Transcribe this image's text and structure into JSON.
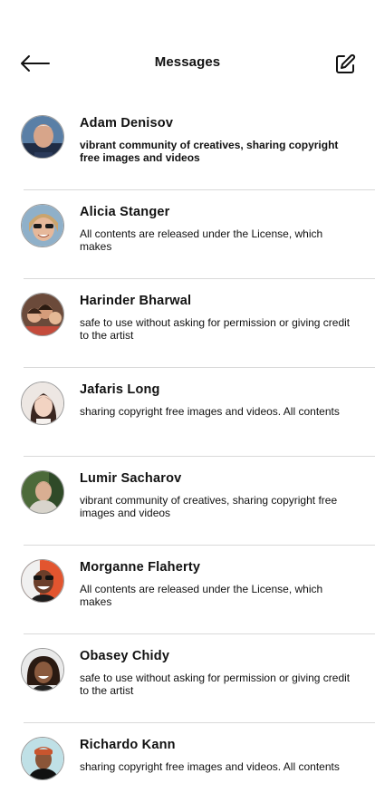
{
  "header": {
    "back_icon": "arrow-left-icon",
    "title": "Messages",
    "compose_icon": "edit-icon"
  },
  "conversations": [
    {
      "name": "Adam Denisov",
      "preview": "vibrant community of creatives, sharing copyright free images and videos",
      "unread": true
    },
    {
      "name": "Alicia Stanger",
      "preview": "All contents are released under the License, which makes",
      "unread": false
    },
    {
      "name": "Harinder Bharwal",
      "preview": "safe to use without asking for permission or giving credit to the artist",
      "unread": false
    },
    {
      "name": "Jafaris Long",
      "preview": "sharing copyright free images and videos. All contents",
      "unread": false
    },
    {
      "name": "Lumir Sacharov",
      "preview": "vibrant community of creatives, sharing copyright free images and videos",
      "unread": false
    },
    {
      "name": "Morganne Flaherty",
      "preview": "All contents are released under the License, which makes",
      "unread": false
    },
    {
      "name": "Obasey Chidy",
      "preview": "safe to use without asking for permission or giving credit to the artist",
      "unread": false
    },
    {
      "name": "Richardo Kann",
      "preview": "sharing copyright free images and videos. All contents",
      "unread": false
    }
  ]
}
